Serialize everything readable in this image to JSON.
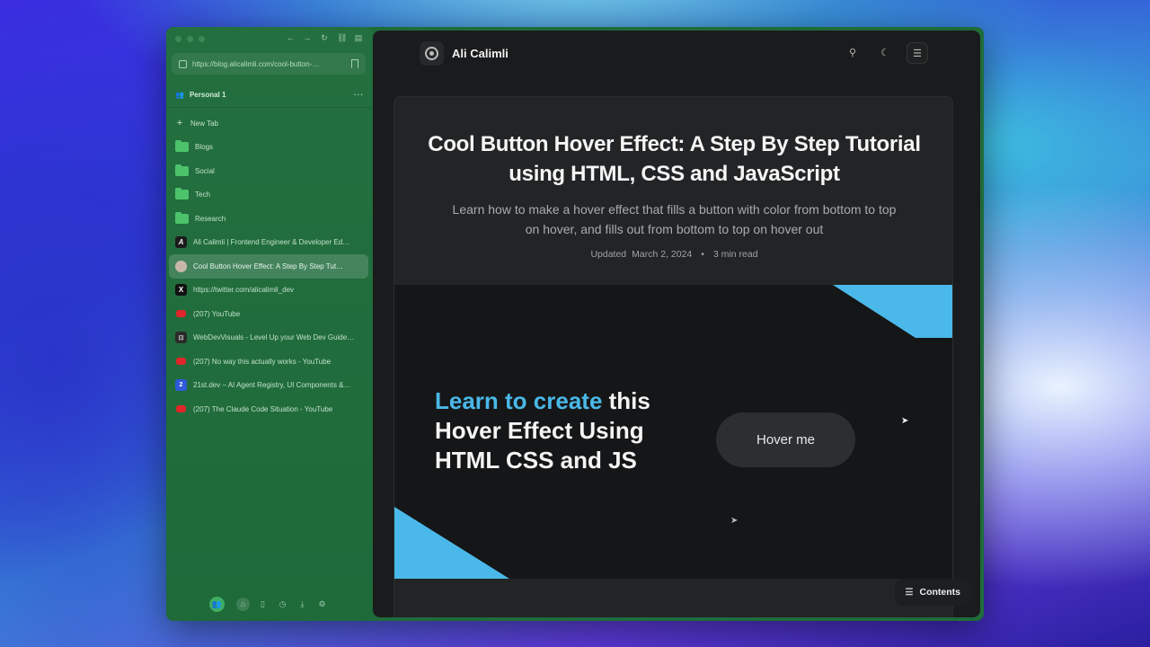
{
  "sidebar": {
    "url": "https://blog.alicalimli.com/cool-button-…",
    "space_name": "Personal 1",
    "more": "···",
    "new_tab": "New Tab",
    "items": [
      {
        "label": "Blogs",
        "kind": "folder"
      },
      {
        "label": "Social",
        "kind": "folder"
      },
      {
        "label": "Tech",
        "kind": "folder"
      },
      {
        "label": "Research",
        "kind": "folder"
      },
      {
        "label": "Ali Calimli | Frontend Engineer & Developer Ed…",
        "kind": "ali"
      },
      {
        "label": "Cool Button Hover Effect: A Step By Step Tut…",
        "kind": "avatar",
        "active": true
      },
      {
        "label": "https://twitter.com/alicalimli_dev",
        "kind": "x"
      },
      {
        "label": "(207) YouTube",
        "kind": "youtube"
      },
      {
        "label": "WebDevVisuals - Level Up your Web Dev Guide…",
        "kind": "wdv"
      },
      {
        "label": "(207) No way this actually works - YouTube",
        "kind": "youtube"
      },
      {
        "label": "21st.dev – AI Agent Registry, UI Components &…",
        "kind": "21st"
      },
      {
        "label": "(207) The Claude Code Situation - YouTube",
        "kind": "youtube"
      }
    ]
  },
  "site": {
    "brand": "Ali Calimli"
  },
  "article": {
    "title": "Cool Button Hover Effect: A Step By Step Tutorial using HTML, CSS and JavaScript",
    "subtitle": "Learn how to make a hover effect that fills a button with color from bottom to top on hover, and fills out from bottom to top on hover out",
    "updated_label": "Updated",
    "date": "March 2, 2024",
    "separator": "•",
    "read_time": "3 min read"
  },
  "hero": {
    "accent_text": "Learn to create",
    "rest_text": " this Hover Effect Using HTML CSS and JS",
    "button_label": "Hover me"
  },
  "contents_label": "Contents",
  "colors": {
    "sidebar": "#1f6b3a",
    "accent_blue": "#4ab8e8",
    "page_bg": "#1a1b1c"
  }
}
